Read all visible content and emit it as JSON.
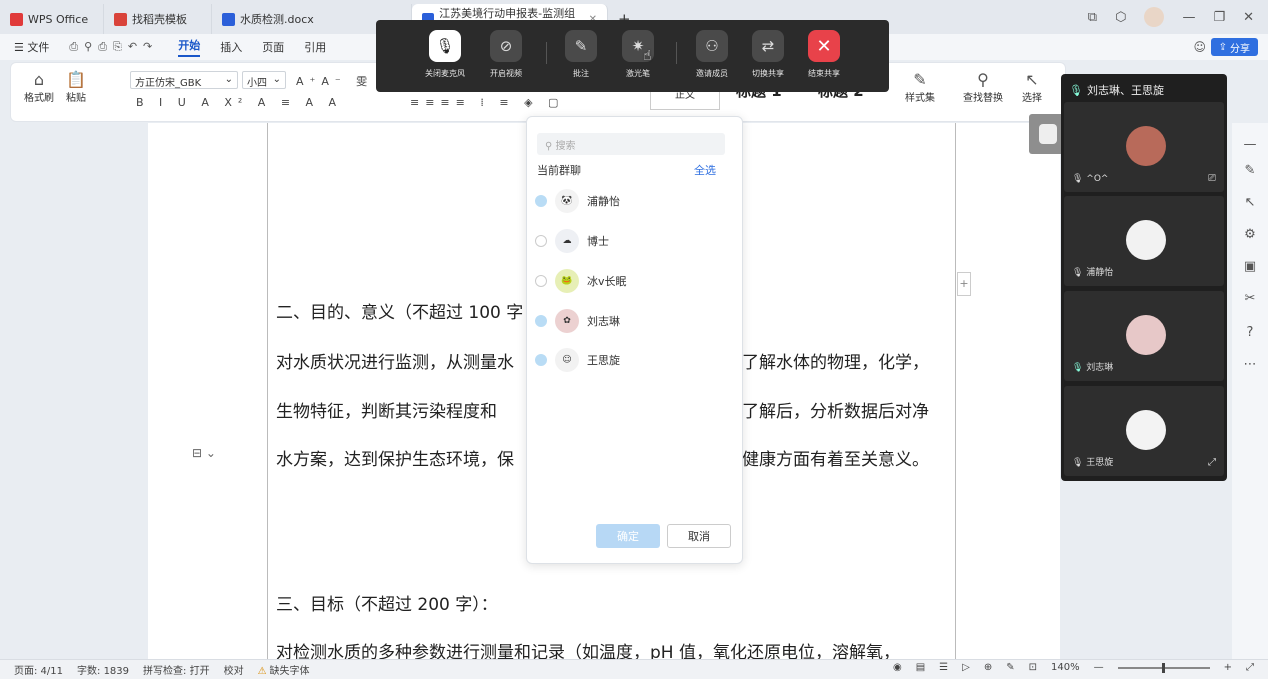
{
  "tabs": [
    {
      "label": "WPS Office",
      "icon": "wps-logo-icon"
    },
    {
      "label": "找稻壳模板",
      "icon": "docer-icon"
    },
    {
      "label": "水质检测.docx",
      "icon": "word-doc-icon"
    },
    {
      "label": "江苏美境行动申报表-监测组(…",
      "icon": "word-doc-icon"
    }
  ],
  "menu": {
    "file": "文件",
    "items": [
      "开始",
      "插入",
      "页面",
      "引用"
    ],
    "active": "开始",
    "share": "分享"
  },
  "ribbon": {
    "format_painter": "格式刷",
    "paste": "粘贴",
    "font_name": "方正仿宋_GBK",
    "font_size": "小四",
    "style_normal": "正文",
    "style_h1": "标题 1",
    "style_h2": "标题 2",
    "style_set": "样式集",
    "find_replace": "查找替换",
    "select": "选择"
  },
  "meeting_toolbar": {
    "buttons": [
      {
        "label": "关闭麦克风",
        "icon": "microphone-icon"
      },
      {
        "label": "开启视频",
        "icon": "video-off-icon"
      },
      {
        "label": "批注",
        "icon": "pen-icon"
      },
      {
        "label": "激光笔",
        "icon": "laser-pointer-icon"
      },
      {
        "label": "邀请成员",
        "icon": "add-user-icon"
      },
      {
        "label": "切换共享",
        "icon": "switch-icon"
      },
      {
        "label": "结束共享",
        "icon": "close-icon"
      }
    ]
  },
  "document": {
    "lines": [
      "二、目的、意义（不超过 100 字",
      "对水质状况进行监测，从测量水",
      "生物特征，判断其污染程度和",
      "水方案，达到保护生态环境，保",
      "三、目标（不超过 200 字）：",
      "对检测水质的多种参数进行测量和记录（如温度，pH 值，氧化还原电位，溶解氧，"
    ],
    "right_fragments": [
      "了解水体的物理，化学，",
      "了解后，分析数据后对净",
      "健康方面有着至关意义。"
    ]
  },
  "invite_popup": {
    "search_placeholder": "搜索",
    "group_label": "当前群聊",
    "select_all": "全选",
    "members": [
      {
        "name": "浦静怡",
        "selected": true
      },
      {
        "name": "博士",
        "selected": false
      },
      {
        "name": "冰v长眠",
        "selected": false
      },
      {
        "name": "刘志琳",
        "selected": true
      },
      {
        "name": "王思旋",
        "selected": true
      }
    ],
    "confirm": "确定",
    "cancel": "取消"
  },
  "participants": {
    "title": "刘志琳、王思旋",
    "list": [
      {
        "name": "^O^",
        "color": "#b86a5a"
      },
      {
        "name": "浦静怡",
        "color": "#f2f2f2"
      },
      {
        "name": "刘志琳",
        "color": "#e7c8c8"
      },
      {
        "name": "王思旋",
        "color": "#f3f3f3"
      }
    ]
  },
  "status": {
    "page": "页面: 4/11",
    "words": "字数: 1839",
    "spell": "拼写检查: 打开",
    "proof": "校对",
    "missing_font": "缺失字体",
    "zoom": "140%"
  }
}
